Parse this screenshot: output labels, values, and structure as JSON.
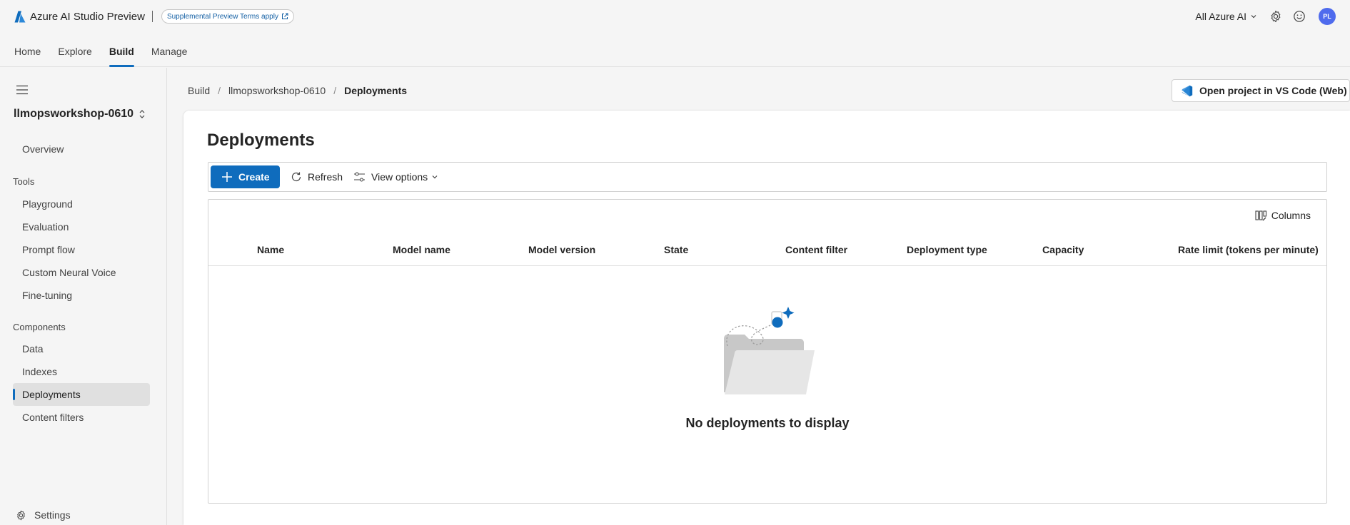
{
  "header": {
    "app_name": "Azure AI Studio",
    "app_suffix": "Preview",
    "terms_pill": "Supplemental Preview Terms apply",
    "scope": "All Azure AI",
    "avatar_initials": "PL"
  },
  "nav": {
    "tabs": [
      {
        "label": "Home"
      },
      {
        "label": "Explore"
      },
      {
        "label": "Build"
      },
      {
        "label": "Manage"
      }
    ],
    "active": "Build"
  },
  "sidebar": {
    "project_name": "llmopsworkshop-0610",
    "overview": "Overview",
    "tools_heading": "Tools",
    "tools": [
      {
        "label": "Playground"
      },
      {
        "label": "Evaluation"
      },
      {
        "label": "Prompt flow"
      },
      {
        "label": "Custom Neural Voice"
      },
      {
        "label": "Fine-tuning"
      }
    ],
    "components_heading": "Components",
    "components": [
      {
        "label": "Data"
      },
      {
        "label": "Indexes"
      },
      {
        "label": "Deployments"
      },
      {
        "label": "Content filters"
      }
    ],
    "selected": "Deployments",
    "settings": "Settings"
  },
  "breadcrumb": {
    "items": [
      "Build",
      "llmopsworkshop-0610",
      "Deployments"
    ]
  },
  "open_vscode_label": "Open project in VS Code (Web)",
  "page": {
    "title": "Deployments",
    "toolbar": {
      "create": "Create",
      "refresh": "Refresh",
      "view_options": "View options"
    },
    "columns_label": "Columns",
    "table_headers": [
      "Name",
      "Model name",
      "Model version",
      "State",
      "Content filter",
      "Deployment type",
      "Capacity",
      "Rate limit (tokens per minute)"
    ],
    "empty_message": "No deployments to display"
  },
  "colors": {
    "accent": "#0f6cbd",
    "avatar": "#4f6bed"
  }
}
